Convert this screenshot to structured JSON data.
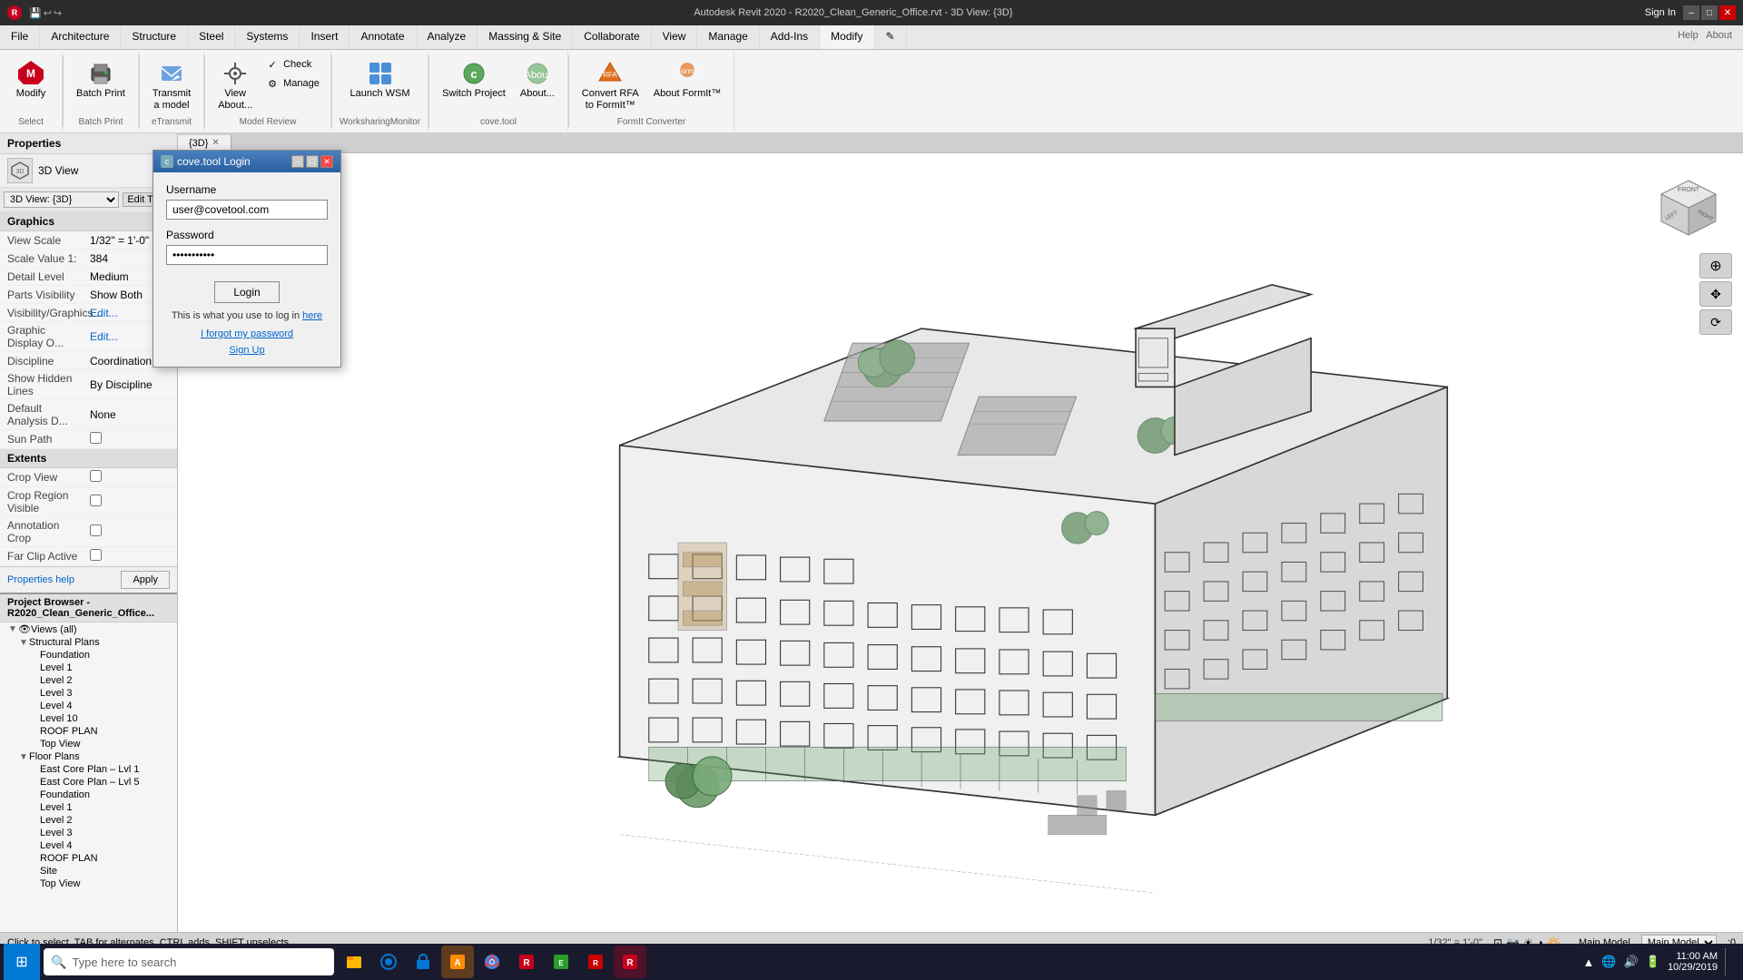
{
  "titlebar": {
    "app_name": "Autodesk Revit 2020 - R2020_Clean_Generic_Office.rvt - 3D View: {3D}",
    "tabs": [
      "R2020_Clean_Generic_Office.rvt"
    ],
    "window_buttons": [
      "–",
      "□",
      "✕"
    ],
    "sign_in": "Sign In",
    "right_icons": [
      "🛒",
      "?"
    ]
  },
  "qat": {
    "buttons": [
      "□",
      "↩",
      "↪",
      "💾",
      "⚙"
    ]
  },
  "ribbon": {
    "tabs": [
      "File",
      "Architecture",
      "Structure",
      "Steel",
      "Systems",
      "Insert",
      "Annotate",
      "Analyze",
      "Massing & Site",
      "Collaborate",
      "View",
      "Manage",
      "Add-Ins",
      "Modify",
      "✎"
    ],
    "active_tab": "Modify",
    "groups": [
      {
        "label": "Select",
        "items": [
          {
            "label": "Modify",
            "icon": "modify"
          },
          {
            "label": "Batch Print",
            "icon": "print"
          }
        ]
      },
      {
        "label": "eTransmit",
        "items": [
          {
            "label": "Transmit a model",
            "icon": "transmit"
          }
        ]
      },
      {
        "label": "Model Review",
        "items": [
          {
            "label": "Check",
            "icon": "check"
          },
          {
            "label": "Manage",
            "icon": "manage"
          }
        ]
      },
      {
        "label": "WorksharingMonitor",
        "items": [
          {
            "label": "Launch WSM",
            "icon": "wsm"
          }
        ]
      },
      {
        "label": "cove.tool",
        "items": [
          {
            "label": "Switch Project",
            "icon": "switch"
          },
          {
            "label": "About...",
            "icon": "about_covetool"
          }
        ]
      },
      {
        "label": "FormIt Converter",
        "items": [
          {
            "label": "Convert RFA to FormIt™",
            "icon": "convert"
          },
          {
            "label": "About FormIt™",
            "icon": "about_formit"
          }
        ]
      }
    ],
    "help_about": [
      "Help",
      "About"
    ]
  },
  "properties": {
    "header": "Properties",
    "type_name": "3D View",
    "type_icon": "3d-cube",
    "view_selector": "3D View: {3D}",
    "edit_type_label": "Edit Type",
    "section_graphics": "Graphics",
    "rows": [
      {
        "label": "View Scale",
        "value": "1/32\" = 1'-0\""
      },
      {
        "label": "Scale Value 1:",
        "value": "384"
      },
      {
        "label": "Detail Level",
        "value": "Medium"
      },
      {
        "label": "Parts Visibility",
        "value": "Show Both"
      },
      {
        "label": "Visibility/Graphics...",
        "value": "Edit..."
      },
      {
        "label": "Graphic Display O...",
        "value": "Edit..."
      },
      {
        "label": "Discipline",
        "value": "Coordination"
      },
      {
        "label": "Show Hidden Lines",
        "value": "By Discipline"
      },
      {
        "label": "Default Analysis D...",
        "value": "None"
      },
      {
        "label": "Sun Path",
        "value": "checkbox"
      }
    ],
    "section_extents": "Extents",
    "extents_rows": [
      {
        "label": "Crop View",
        "value": "checkbox"
      },
      {
        "label": "Crop Region Visible",
        "value": "checkbox"
      },
      {
        "label": "Annotation Crop",
        "value": "checkbox"
      },
      {
        "label": "Far Clip Active",
        "value": "checkbox"
      }
    ],
    "apply_btn": "Apply",
    "help_link": "Properties help"
  },
  "project_browser": {
    "header": "Project Browser - R2020_Clean_Generic_Office...",
    "tree": [
      {
        "level": 1,
        "label": "Views (all)",
        "type": "folder",
        "expanded": true
      },
      {
        "level": 2,
        "label": "Structural Plans",
        "type": "folder",
        "expanded": true
      },
      {
        "level": 3,
        "label": "Foundation",
        "type": "view"
      },
      {
        "level": 3,
        "label": "Level 1",
        "type": "view"
      },
      {
        "level": 3,
        "label": "Level 2",
        "type": "view"
      },
      {
        "level": 3,
        "label": "Level 3",
        "type": "view"
      },
      {
        "level": 3,
        "label": "Level 4",
        "type": "view"
      },
      {
        "level": 3,
        "label": "Level 10",
        "type": "view"
      },
      {
        "level": 3,
        "label": "ROOF PLAN",
        "type": "view"
      },
      {
        "level": 3,
        "label": "Top View",
        "type": "view"
      },
      {
        "level": 2,
        "label": "Floor Plans",
        "type": "folder",
        "expanded": true
      },
      {
        "level": 3,
        "label": "East Core Plan – Lvl 1",
        "type": "view"
      },
      {
        "level": 3,
        "label": "East Core Plan – Lvl 5",
        "type": "view"
      },
      {
        "level": 3,
        "label": "Foundation",
        "type": "view"
      },
      {
        "level": 3,
        "label": "Level 1",
        "type": "view"
      },
      {
        "level": 3,
        "label": "Level 2",
        "type": "view"
      },
      {
        "level": 3,
        "label": "Level 3",
        "type": "view"
      },
      {
        "level": 3,
        "label": "Level 4",
        "type": "view"
      },
      {
        "level": 3,
        "label": "ROOF PLAN",
        "type": "view"
      },
      {
        "level": 3,
        "label": "Site",
        "type": "view"
      },
      {
        "level": 3,
        "label": "Top View",
        "type": "view"
      }
    ]
  },
  "viewport": {
    "tab_label": "{3D}",
    "view_title": "3D View: {3D}",
    "scale_text": "1/32\" = 1'-0\"",
    "status_text": "Click to select, TAB for alternates, CTRL adds, SHIFT unselects.",
    "workset": "Main Model",
    "active_only": ":0"
  },
  "login_dialog": {
    "title": "cove.tool Login",
    "username_label": "Username",
    "username_value": "user@covetool.com",
    "password_label": "Password",
    "password_value": "••••••••••••••",
    "login_btn": "Login",
    "info_text": "This is what you use to log in",
    "info_link_text": "here",
    "forgot_link": "I forgot my password",
    "signup_link": "Sign Up"
  },
  "taskbar": {
    "search_placeholder": "Type here to search",
    "clock": "11:00 AM\n10/29/2019",
    "time": "11:00 AM",
    "date": "10/29/2019"
  },
  "colors": {
    "accent": "#0078d4",
    "ribbon_active": "#f4f4f4",
    "property_label": "#444",
    "link": "#0066cc"
  }
}
